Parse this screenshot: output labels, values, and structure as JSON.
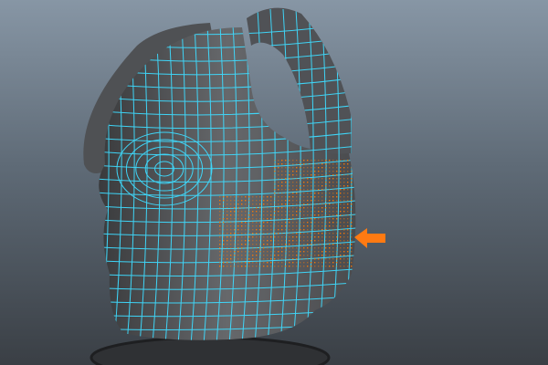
{
  "viewport": {
    "background_top": "#8796a5",
    "background_bottom": "#3a3f45",
    "mesh_color": "#5a5c5f",
    "wireframe_color": "#3fdcff",
    "selection_color": "#ff7a00",
    "arrow_color": "#ff7a12",
    "arrow_icon": "arrow-left-icon"
  }
}
